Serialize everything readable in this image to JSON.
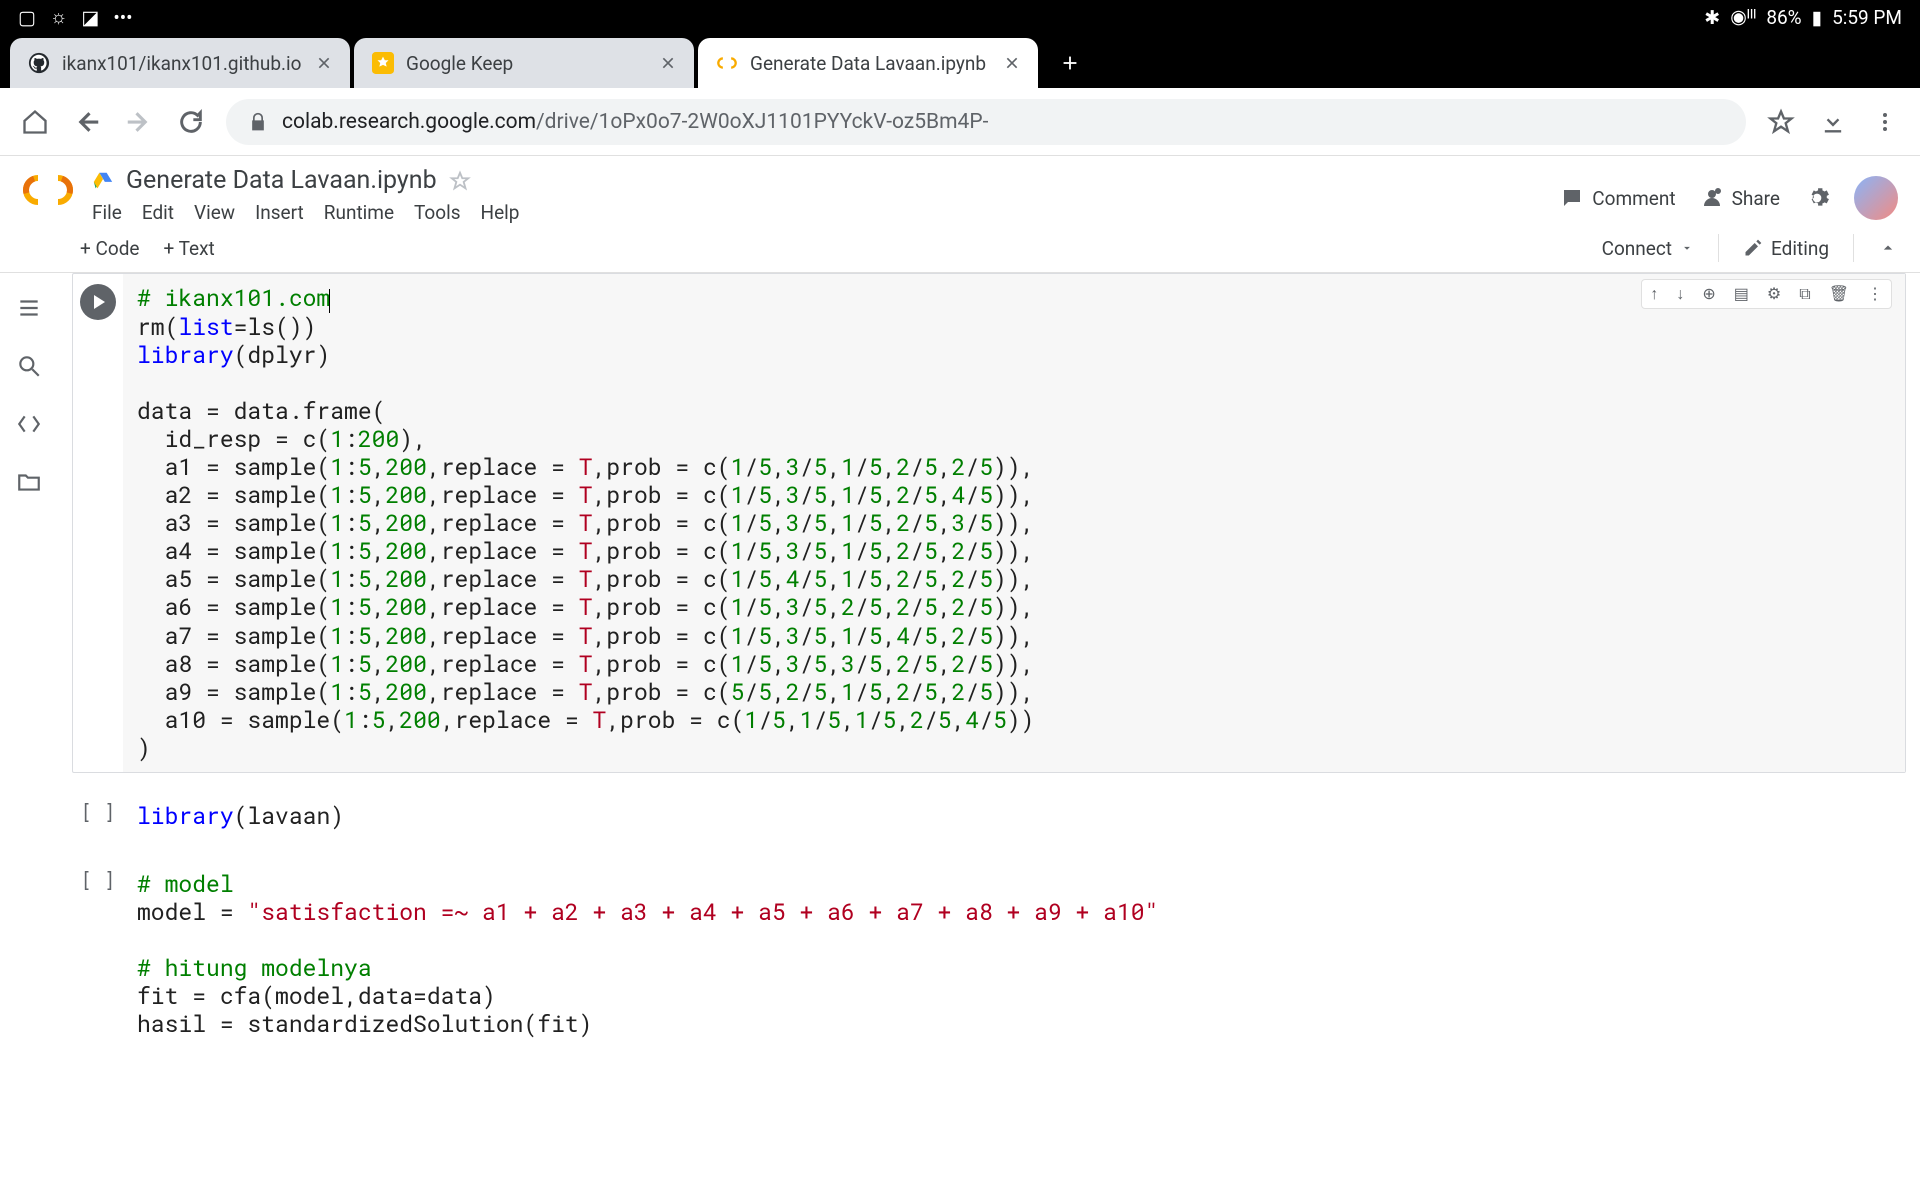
{
  "status_bar": {
    "battery": "86%",
    "time": "5:59 PM"
  },
  "tabs": [
    {
      "title": "ikanx101/ikanx101.github.io",
      "active": false
    },
    {
      "title": "Google Keep",
      "active": false
    },
    {
      "title": "Generate Data Lavaan.ipynb",
      "active": true
    }
  ],
  "url": {
    "domain": "colab.research.google.com",
    "path": "/drive/1oPx0o7-2W0oXJ1101PYYckV-oz5Bm4P-"
  },
  "colab": {
    "title": "Generate Data Lavaan.ipynb",
    "menus": [
      "File",
      "Edit",
      "View",
      "Insert",
      "Runtime",
      "Tools",
      "Help"
    ],
    "actions": {
      "comment": "Comment",
      "share": "Share"
    },
    "toolbar": {
      "code": "+ Code",
      "text": "+ Text",
      "connect": "Connect",
      "editing": "Editing"
    }
  },
  "cells": [
    {
      "prompt_type": "run",
      "selected": true,
      "code_html": "<span class='c-comment'># ikanx101.com</span><span class='cursor'></span>\nrm(<span class='c-kw'>list</span>=ls())\n<span class='c-kw'>library</span>(dplyr)\n\ndata = data.frame(\n  id_resp = c(<span class='c-num'>1</span>:<span class='c-num'>200</span>),\n  a1 = sample(<span class='c-num'>1</span>:<span class='c-num'>5</span>,<span class='c-num'>200</span>,replace = <span class='c-true'>T</span>,prob = c(<span class='c-num'>1</span>/<span class='c-num'>5</span>,<span class='c-num'>3</span>/<span class='c-num'>5</span>,<span class='c-num'>1</span>/<span class='c-num'>5</span>,<span class='c-num'>2</span>/<span class='c-num'>5</span>,<span class='c-num'>2</span>/<span class='c-num'>5</span>)),\n  a2 = sample(<span class='c-num'>1</span>:<span class='c-num'>5</span>,<span class='c-num'>200</span>,replace = <span class='c-true'>T</span>,prob = c(<span class='c-num'>1</span>/<span class='c-num'>5</span>,<span class='c-num'>3</span>/<span class='c-num'>5</span>,<span class='c-num'>1</span>/<span class='c-num'>5</span>,<span class='c-num'>2</span>/<span class='c-num'>5</span>,<span class='c-num'>4</span>/<span class='c-num'>5</span>)),\n  a3 = sample(<span class='c-num'>1</span>:<span class='c-num'>5</span>,<span class='c-num'>200</span>,replace = <span class='c-true'>T</span>,prob = c(<span class='c-num'>1</span>/<span class='c-num'>5</span>,<span class='c-num'>3</span>/<span class='c-num'>5</span>,<span class='c-num'>1</span>/<span class='c-num'>5</span>,<span class='c-num'>2</span>/<span class='c-num'>5</span>,<span class='c-num'>3</span>/<span class='c-num'>5</span>)),\n  a4 = sample(<span class='c-num'>1</span>:<span class='c-num'>5</span>,<span class='c-num'>200</span>,replace = <span class='c-true'>T</span>,prob = c(<span class='c-num'>1</span>/<span class='c-num'>5</span>,<span class='c-num'>3</span>/<span class='c-num'>5</span>,<span class='c-num'>1</span>/<span class='c-num'>5</span>,<span class='c-num'>2</span>/<span class='c-num'>5</span>,<span class='c-num'>2</span>/<span class='c-num'>5</span>)),\n  a5 = sample(<span class='c-num'>1</span>:<span class='c-num'>5</span>,<span class='c-num'>200</span>,replace = <span class='c-true'>T</span>,prob = c(<span class='c-num'>1</span>/<span class='c-num'>5</span>,<span class='c-num'>4</span>/<span class='c-num'>5</span>,<span class='c-num'>1</span>/<span class='c-num'>5</span>,<span class='c-num'>2</span>/<span class='c-num'>5</span>,<span class='c-num'>2</span>/<span class='c-num'>5</span>)),\n  a6 = sample(<span class='c-num'>1</span>:<span class='c-num'>5</span>,<span class='c-num'>200</span>,replace = <span class='c-true'>T</span>,prob = c(<span class='c-num'>1</span>/<span class='c-num'>5</span>,<span class='c-num'>3</span>/<span class='c-num'>5</span>,<span class='c-num'>2</span>/<span class='c-num'>5</span>,<span class='c-num'>2</span>/<span class='c-num'>5</span>,<span class='c-num'>2</span>/<span class='c-num'>5</span>)),\n  a7 = sample(<span class='c-num'>1</span>:<span class='c-num'>5</span>,<span class='c-num'>200</span>,replace = <span class='c-true'>T</span>,prob = c(<span class='c-num'>1</span>/<span class='c-num'>5</span>,<span class='c-num'>3</span>/<span class='c-num'>5</span>,<span class='c-num'>1</span>/<span class='c-num'>5</span>,<span class='c-num'>4</span>/<span class='c-num'>5</span>,<span class='c-num'>2</span>/<span class='c-num'>5</span>)),\n  a8 = sample(<span class='c-num'>1</span>:<span class='c-num'>5</span>,<span class='c-num'>200</span>,replace = <span class='c-true'>T</span>,prob = c(<span class='c-num'>1</span>/<span class='c-num'>5</span>,<span class='c-num'>3</span>/<span class='c-num'>5</span>,<span class='c-num'>3</span>/<span class='c-num'>5</span>,<span class='c-num'>2</span>/<span class='c-num'>5</span>,<span class='c-num'>2</span>/<span class='c-num'>5</span>)),\n  a9 = sample(<span class='c-num'>1</span>:<span class='c-num'>5</span>,<span class='c-num'>200</span>,replace = <span class='c-true'>T</span>,prob = c(<span class='c-num'>5</span>/<span class='c-num'>5</span>,<span class='c-num'>2</span>/<span class='c-num'>5</span>,<span class='c-num'>1</span>/<span class='c-num'>5</span>,<span class='c-num'>2</span>/<span class='c-num'>5</span>,<span class='c-num'>2</span>/<span class='c-num'>5</span>)),\n  a10 = sample(<span class='c-num'>1</span>:<span class='c-num'>5</span>,<span class='c-num'>200</span>,replace = <span class='c-true'>T</span>,prob = c(<span class='c-num'>1</span>/<span class='c-num'>5</span>,<span class='c-num'>1</span>/<span class='c-num'>5</span>,<span class='c-num'>1</span>/<span class='c-num'>5</span>,<span class='c-num'>2</span>/<span class='c-num'>5</span>,<span class='c-num'>4</span>/<span class='c-num'>5</span>))\n)"
    },
    {
      "prompt_type": "bracket",
      "selected": false,
      "code_html": "<span class='c-kw'>library</span>(lavaan)"
    },
    {
      "prompt_type": "bracket",
      "selected": false,
      "code_html": "<span class='c-comment'># model</span>\nmodel = <span class='c-str'>\"satisfaction =~ a1 + a2 + a3 + a4 + a5 + a6 + a7 + a8 + a9 + a10\"</span>\n\n<span class='c-comment'># hitung modelnya</span>\nfit = cfa(model,data=data)\nhasil = standardizedSolution(fit)"
    }
  ]
}
